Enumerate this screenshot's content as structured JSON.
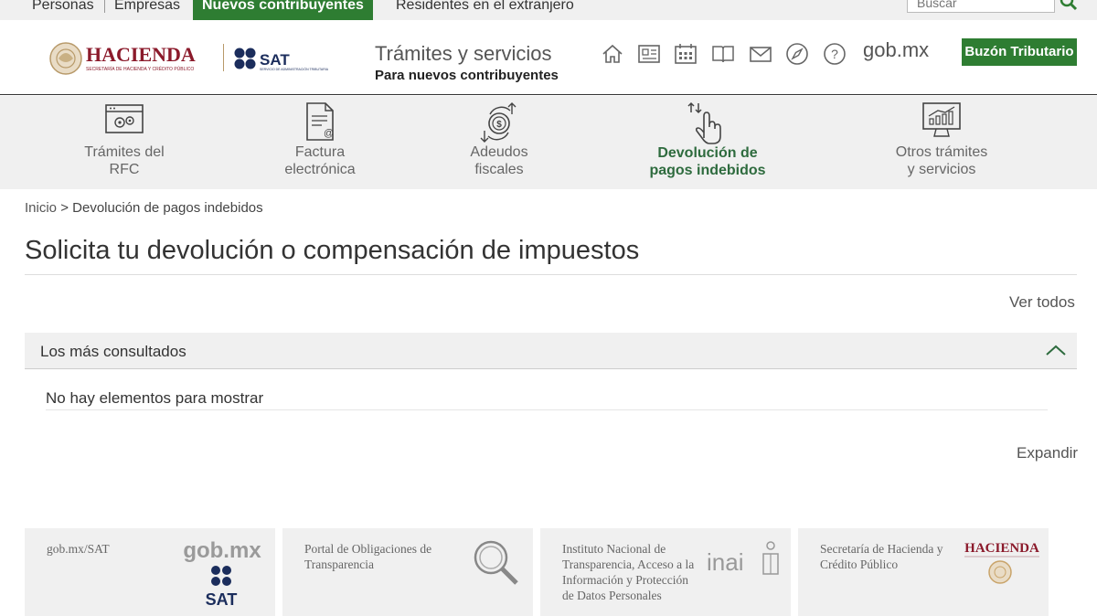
{
  "topbar": {
    "tabs": [
      "Personas",
      "Empresas",
      "Nuevos contribuyentes",
      "Residentes en el extranjero"
    ],
    "search_placeholder": "Buscar"
  },
  "header": {
    "hacienda_logo": "HACIENDA",
    "hacienda_logo_sub": "SECRETARÍA DE HACIENDA Y CRÉDITO PÚBLICO",
    "sat_logo": "SAT",
    "sat_logo_sub": "SERVICIO DE ADMINISTRACIÓN TRIBUTARIA",
    "title": "Trámites y servicios",
    "subtitle": "Para nuevos contribuyentes",
    "icons": [
      "home-icon",
      "news-icon",
      "calendar-icon",
      "book-icon",
      "mail-icon",
      "compass-icon",
      "help-icon"
    ],
    "gobmx": "gob.mx",
    "buzon_label": "Buzón Tributario"
  },
  "nav": {
    "items": [
      {
        "line1": "Trámites del",
        "line2": "RFC",
        "icon": "rfc-icon"
      },
      {
        "line1": "Factura",
        "line2": "electrónica",
        "icon": "invoice-icon"
      },
      {
        "line1": "Adeudos",
        "line2": "fiscales",
        "icon": "debt-icon"
      },
      {
        "line1": "Devolución de",
        "line2": "pagos indebidos",
        "icon": "refund-icon",
        "active": true
      },
      {
        "line1": "Otros trámites",
        "line2": "y servicios",
        "icon": "services-icon"
      }
    ]
  },
  "breadcrumb": {
    "home": "Inicio",
    "separator": ">",
    "current": "Devolución de pagos indebidos"
  },
  "page_title": "Solicita tu devolución o compensación de impuestos",
  "ver_todos": "Ver todos",
  "accordion": {
    "title": "Los más consultados",
    "empty": "No hay elementos para mostrar"
  },
  "expandir": "Expandir",
  "footer": {
    "cards": [
      {
        "text": "gob.mx/SAT",
        "logo_top": "gob.mx",
        "logo_bottom": "SAT"
      },
      {
        "text": "Portal de Obligaciones de Transparencia"
      },
      {
        "text": "Instituto Nacional de Transparencia, Acceso a la Información y Protección de Datos Personales",
        "logo": "inai"
      },
      {
        "text": "Secretaría de Hacienda y Crédito Público",
        "logo": "HACIENDA"
      }
    ]
  },
  "colors": {
    "brand_green": "#2e7d32",
    "active_nav_text": "#2e6b3e",
    "hacienda_red": "#8b1a2b",
    "sat_blue": "#1b2d5c"
  }
}
